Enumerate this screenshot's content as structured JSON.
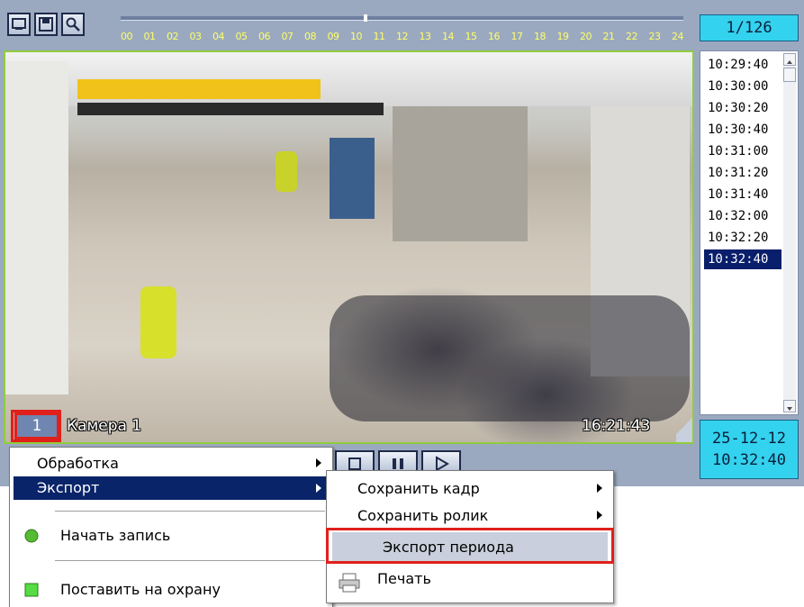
{
  "timeline": {
    "hours": [
      "00",
      "01",
      "02",
      "03",
      "04",
      "05",
      "06",
      "07",
      "08",
      "09",
      "10",
      "11",
      "12",
      "13",
      "14",
      "15",
      "16",
      "17",
      "18",
      "19",
      "20",
      "21",
      "22",
      "23",
      "24"
    ]
  },
  "counter": "1/126",
  "camera": {
    "number": "1",
    "name": "Камера 1",
    "time": "16:21:43"
  },
  "time_list": {
    "items": [
      "10:29:40",
      "10:30:00",
      "10:30:20",
      "10:30:40",
      "10:31:00",
      "10:31:20",
      "10:31:40",
      "10:32:00",
      "10:32:20",
      "10:32:40"
    ],
    "selected": "10:32:40"
  },
  "datetime": {
    "date": "25-12-12",
    "time": "10:32:40"
  },
  "context_menu": {
    "processing": "Обработка",
    "export": "Экспорт",
    "start_record": "Начать запись",
    "arm": "Поставить на охрану"
  },
  "export_submenu": {
    "save_frame": "Сохранить кадр",
    "save_clip": "Сохранить ролик",
    "export_period": "Экспорт периода",
    "print": "Печать"
  },
  "colors": {
    "frame": "#9aa9c0",
    "accent_cyan": "#33d2ee",
    "highlight": "#0a246a",
    "callout_red": "#e0201b",
    "video_border": "#90cc3c"
  }
}
